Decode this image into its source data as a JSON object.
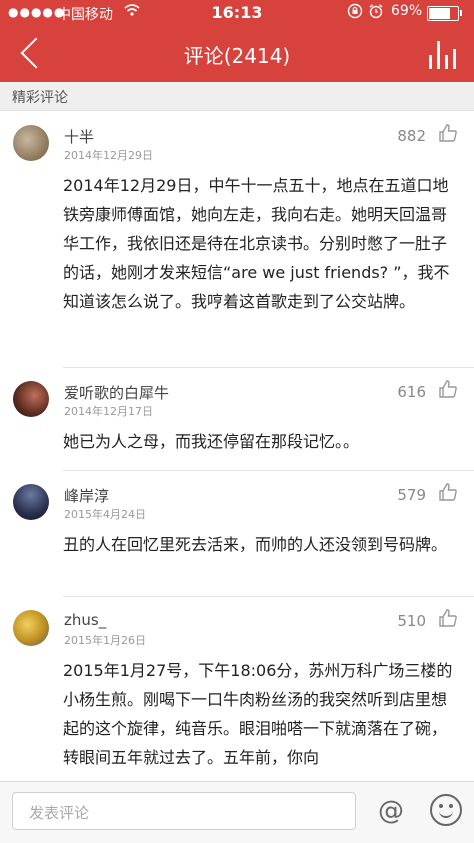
{
  "status_bar": {
    "signal": "●●●●●",
    "carrier": "中国移动",
    "time": "16:13",
    "battery_percent": "69%",
    "battery_level": 0.69
  },
  "header": {
    "title": "评论(2414)",
    "background": "#d8423c"
  },
  "section": {
    "label": "精彩评论"
  },
  "comments": [
    {
      "username": "十半",
      "date": "2014年12月29日",
      "likes": "882",
      "text": "2014年12月29日，中午十一点五十，地点在五道口地铁旁康师傅面馆，她向左走，我向右走。她明天回温哥华工作，我依旧还是待在北京读书。分别时憋了一肚子的话，她刚才发来短信“are we just friends? ”，我不知道该怎么说了。我哼着这首歌走到了公交站牌。"
    },
    {
      "username": "爱听歌的白犀牛",
      "date": "2014年12月17日",
      "likes": "616",
      "text": "她已为人之母，而我还停留在那段记忆。。"
    },
    {
      "username": "峰岸淳",
      "date": "2015年4月24日",
      "likes": "579",
      "text": "丑的人在回忆里死去活来，而帅的人还没领到号码牌。"
    },
    {
      "username": "zhus_",
      "date": "2015年1月26日",
      "likes": "510",
      "text": "2015年1月27号，下午18:06分，苏州万科广场三楼的小杨生煎。刚喝下一口牛肉粉丝汤的我突然听到店里想起的这个旋律，纯音乐。眼泪啪嗒一下就滴落在了碗，转眼间五年就过去了。五年前，你向"
    }
  ],
  "composer": {
    "placeholder": "发表评论"
  }
}
